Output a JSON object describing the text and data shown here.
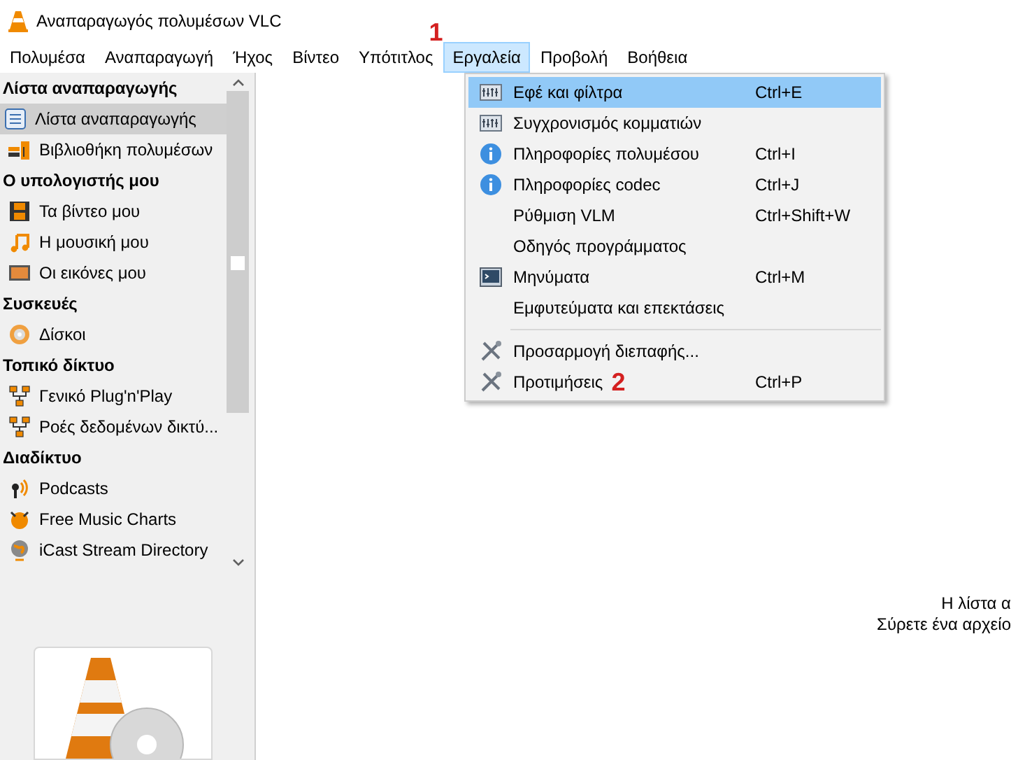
{
  "window": {
    "title": "Αναπαραγωγός πολυμέσων VLC"
  },
  "menu_bar": [
    {
      "label": "Πολυμέσα",
      "selected": false
    },
    {
      "label": "Αναπαραγωγή",
      "selected": false
    },
    {
      "label": "Ήχος",
      "selected": false
    },
    {
      "label": "Βίντεο",
      "selected": false
    },
    {
      "label": "Υπότιτλος",
      "selected": false
    },
    {
      "label": "Εργαλεία",
      "selected": true,
      "annotation": "1"
    },
    {
      "label": "Προβολή",
      "selected": false
    },
    {
      "label": "Βοήθεια",
      "selected": false
    }
  ],
  "tools_menu": [
    {
      "kind": "equalizer",
      "label": "Εφέ και φίλτρα",
      "shortcut": "Ctrl+E",
      "selected": true
    },
    {
      "kind": "equalizer",
      "label": "Συγχρονισμός κομματιών",
      "selected": false
    },
    {
      "kind": "info",
      "label": "Πληροφορίες πολυμέσου",
      "shortcut": "Ctrl+I",
      "selected": false
    },
    {
      "kind": "info",
      "label": "Πληροφορίες codec",
      "shortcut": "Ctrl+J",
      "selected": false
    },
    {
      "kind": "plain",
      "label": "Ρύθμιση VLM",
      "shortcut": "Ctrl+Shift+W",
      "selected": false
    },
    {
      "kind": "plain",
      "label": "Οδηγός προγράμματος",
      "selected": false
    },
    {
      "kind": "terminal",
      "label": "Μηνύματα",
      "shortcut": "Ctrl+M",
      "selected": false
    },
    {
      "kind": "plain",
      "label": "Εμφυτεύματα και επεκτάσεις",
      "selected": false
    },
    {
      "kind": "separator"
    },
    {
      "kind": "tools",
      "label": "Προσαρμογή διεπαφής...",
      "selected": false
    },
    {
      "kind": "tools",
      "label": "Προτιμήσεις",
      "shortcut": "Ctrl+P",
      "selected": false,
      "annotation": "2"
    }
  ],
  "sidebar": [
    {
      "heading": "Λίστα αναπαραγωγής",
      "items": [
        {
          "kind": "playlist",
          "label": "Λίστα αναπαραγωγής",
          "selected": true
        },
        {
          "kind": "library",
          "label": "Βιβλιοθήκη πολυμέσων",
          "selected": false
        }
      ]
    },
    {
      "heading": "Ο υπολογιστής μου",
      "items": [
        {
          "kind": "film",
          "label": "Τα βίντεο μου",
          "selected": false
        },
        {
          "kind": "music",
          "label": "Η μουσική μου",
          "selected": false
        },
        {
          "kind": "picture",
          "label": "Οι εικόνες μου",
          "selected": false
        }
      ]
    },
    {
      "heading": "Συσκευές",
      "items": [
        {
          "kind": "disc",
          "label": "Δίσκοι",
          "selected": false
        }
      ]
    },
    {
      "heading": "Τοπικό δίκτυο",
      "items": [
        {
          "kind": "network",
          "label": "Γενικό Plug'n'Play",
          "selected": false
        },
        {
          "kind": "network",
          "label": "Ροές δεδομένων δικτύ...",
          "selected": false
        }
      ]
    },
    {
      "heading": "Διαδίκτυο",
      "items": [
        {
          "kind": "podcast",
          "label": "Podcasts",
          "selected": false
        },
        {
          "kind": "charts",
          "label": "Free Music Charts",
          "selected": false
        },
        {
          "kind": "globe",
          "label": "iCast Stream Directory",
          "selected": false
        }
      ]
    }
  ],
  "playlist": {
    "lines": [
      "Η λίστα α",
      "Σύρετε ένα αρχείο"
    ]
  }
}
